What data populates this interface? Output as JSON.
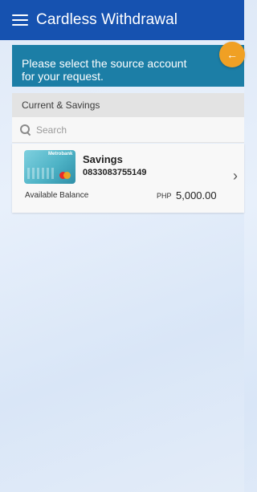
{
  "header": {
    "title": "Cardless Withdrawal"
  },
  "banner": {
    "message": "Please select the source account for your request."
  },
  "section": {
    "title": "Current & Savings"
  },
  "search": {
    "placeholder": "Search"
  },
  "account": {
    "card_brand": "Metrobank",
    "type": "Savings",
    "number": "0833083755149",
    "balance_label": "Available Balance",
    "currency": "PHP",
    "balance": "5,000.00"
  },
  "icons": {
    "menu": "menu-icon",
    "back": "arrow-left-icon",
    "search": "search-icon",
    "chevron": "chevron-right-icon"
  },
  "colors": {
    "appbar": "#1652b0",
    "banner": "#1c7ea6",
    "back_button": "#f0a024"
  }
}
